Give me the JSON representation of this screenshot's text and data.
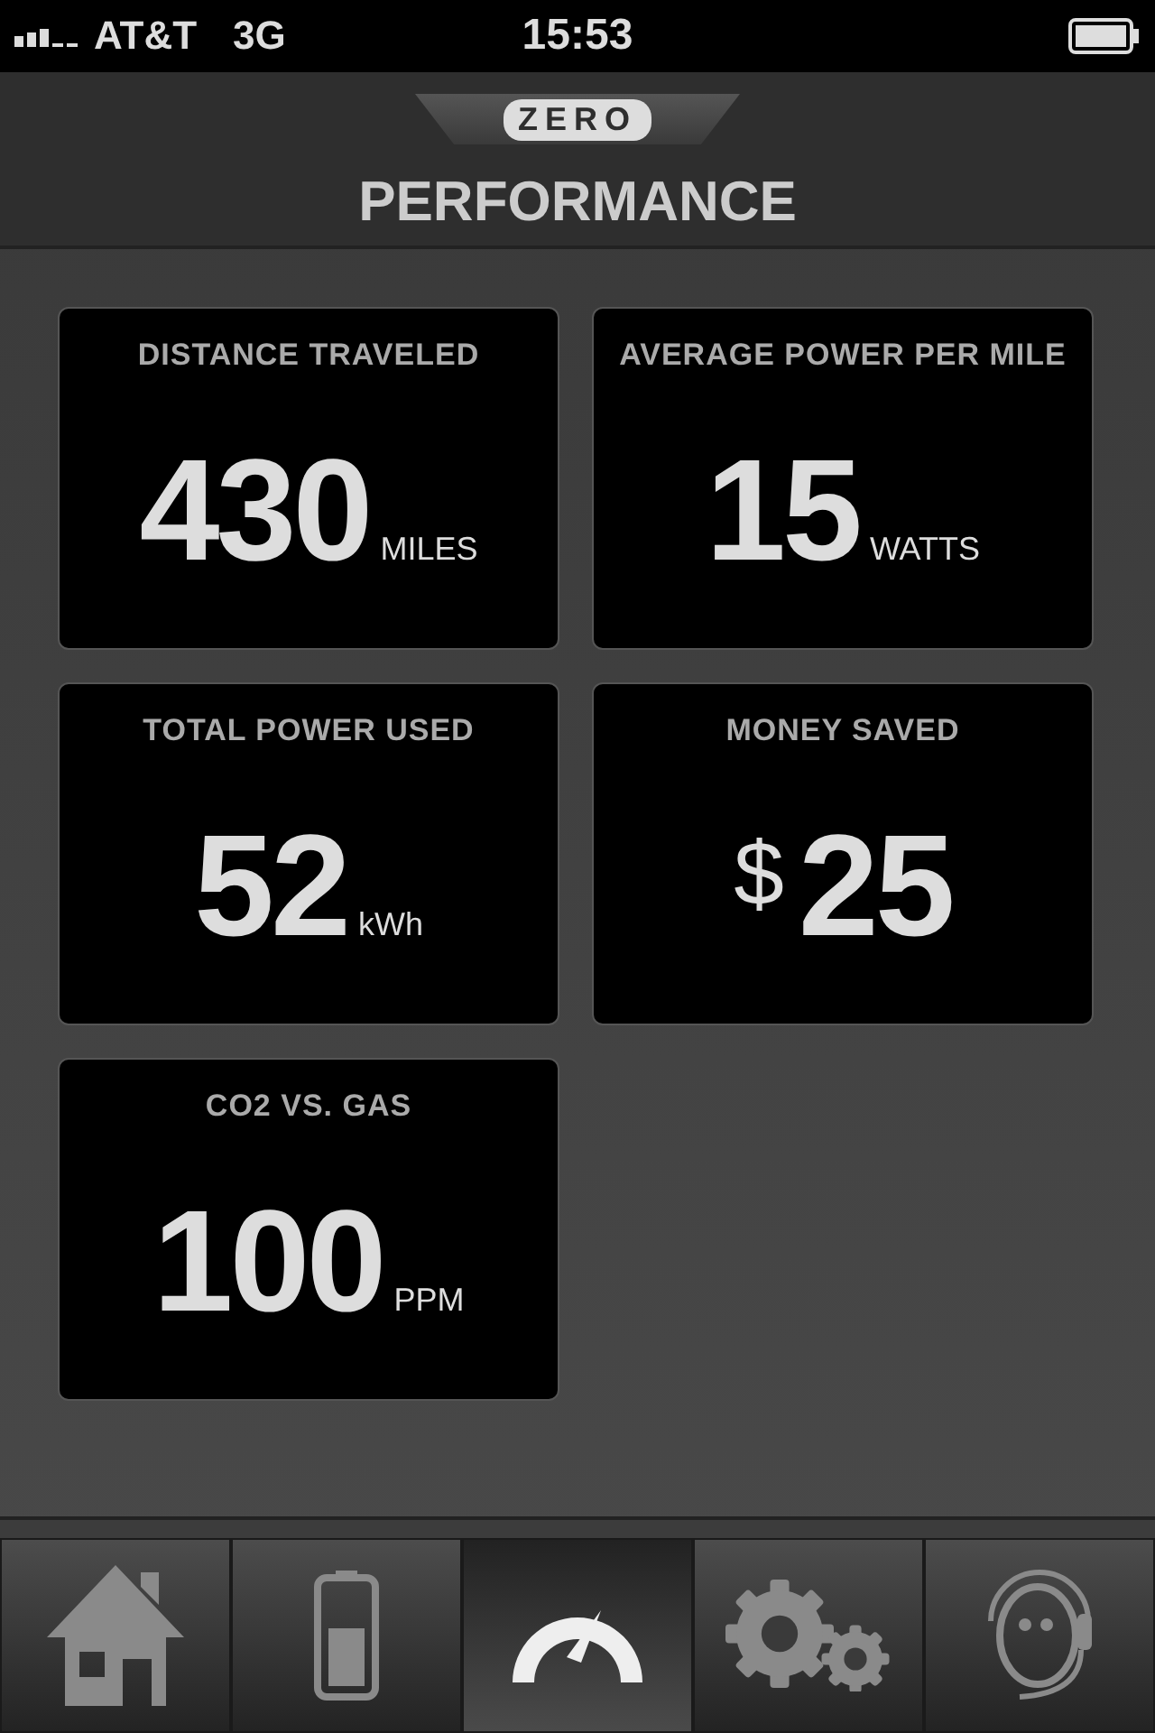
{
  "status_bar": {
    "carrier": "AT&T",
    "network": "3G",
    "time": "15:53"
  },
  "header": {
    "logo": "ZERO",
    "title": "PERFORMANCE"
  },
  "stats": [
    {
      "label": "DISTANCE TRAVELED",
      "value": "430",
      "unit": "MILES"
    },
    {
      "label": "AVERAGE POWER PER MILE",
      "value": "15",
      "unit": "WATTS"
    },
    {
      "label": "TOTAL POWER USED",
      "value": "52",
      "unit": "kWh"
    },
    {
      "label": "MONEY SAVED",
      "prefix": "$",
      "value": "25"
    },
    {
      "label": "CO2 VS. GAS",
      "value": "100",
      "unit": "PPM"
    }
  ],
  "tabs": [
    {
      "kind": "home",
      "selected": false
    },
    {
      "kind": "battery",
      "selected": false
    },
    {
      "kind": "gauge",
      "selected": true
    },
    {
      "kind": "settings",
      "selected": false
    },
    {
      "kind": "support",
      "selected": false
    }
  ]
}
